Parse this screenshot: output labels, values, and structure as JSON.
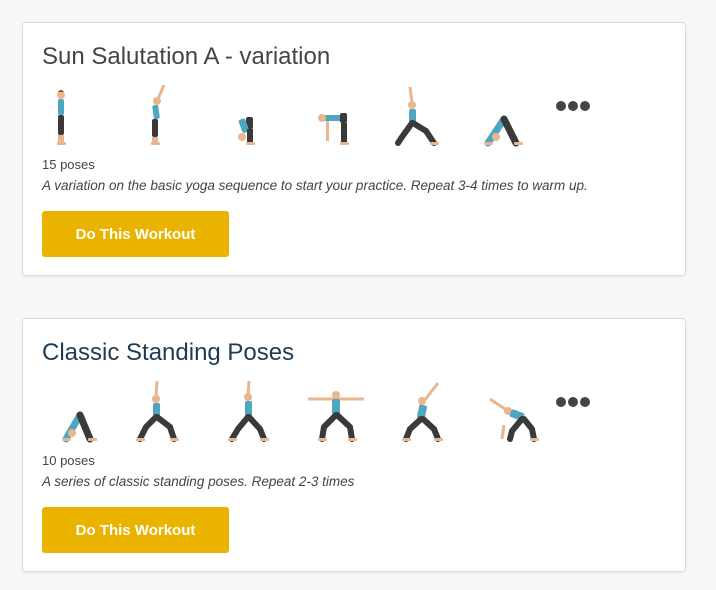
{
  "workouts": [
    {
      "title": "Sun Salutation A - variation",
      "pose_count": "15 poses",
      "description": "A variation on the basic yoga sequence to start your practice. Repeat 3-4 times to warm up.",
      "button_label": "Do This Workout",
      "pose_icons": [
        "mountain-pose-icon",
        "upward-salute-icon",
        "forward-fold-icon",
        "half-lift-icon",
        "chair-pose-icon",
        "downward-dog-icon"
      ],
      "more_icon": "more-poses-icon"
    },
    {
      "title": "Classic Standing Poses",
      "pose_count": "10 poses",
      "description": "A series of classic standing poses. Repeat 2-3 times",
      "button_label": "Do This Workout",
      "pose_icons": [
        "downward-dog-icon",
        "crescent-lunge-icon",
        "warrior-one-icon",
        "warrior-two-icon",
        "reverse-warrior-icon",
        "extended-side-angle-icon"
      ],
      "more_icon": "more-poses-icon"
    }
  ],
  "colors": {
    "button": "#eab300",
    "button_text": "#ffffff",
    "title_1": "#444444",
    "title_2": "#1f3a52",
    "figure_top": "#4fa6bf",
    "figure_pants": "#3a3a3a",
    "figure_skin": "#e9b68f"
  }
}
